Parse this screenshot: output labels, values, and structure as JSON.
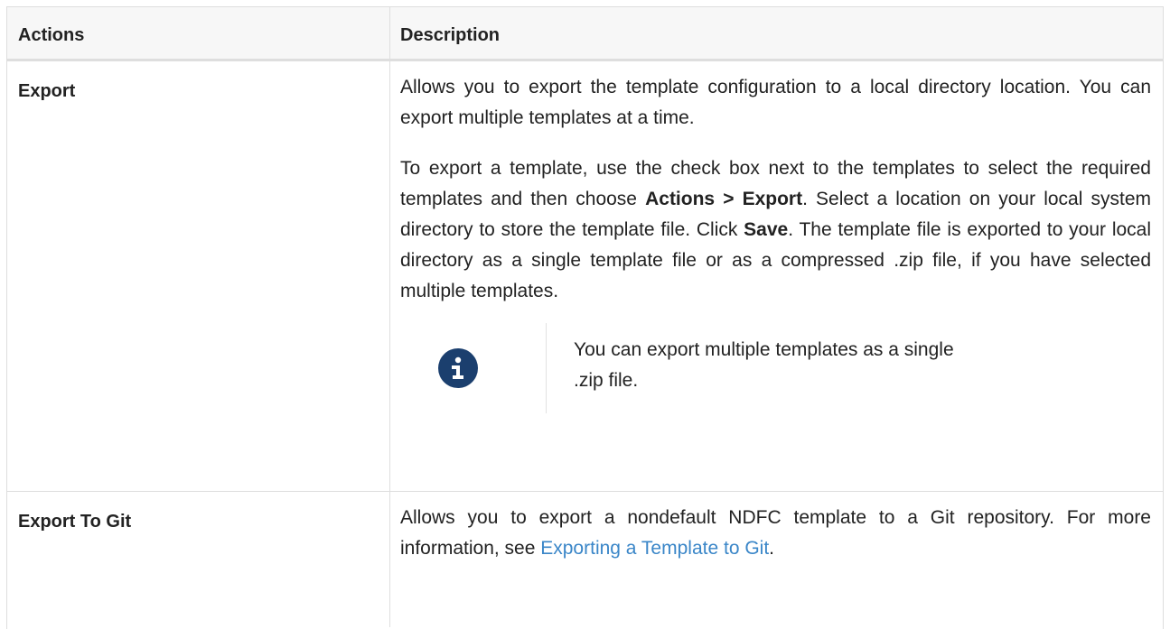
{
  "table": {
    "headers": {
      "actions": "Actions",
      "description": "Description"
    },
    "rows": [
      {
        "action": "Export",
        "p1": "Allows you to export the template configuration to a local directory location. You can export multiple templates at a time.",
        "p2_a": "To export a template, use the check box next to the templates to select the required templates and then choose ",
        "p2_b": "Actions > Export",
        "p2_c": ". Select a location on your local system directory to store the template file. Click ",
        "p2_d": "Save",
        "p2_e": ". The template file is exported to your local directory as a single template file or as a compressed .zip file, if you have selected multiple templates.",
        "note": {
          "icon": "info-icon",
          "text": "You can export multiple templates as a single .zip file."
        }
      },
      {
        "action": "Export To Git",
        "p1_a": "Allows you to export a nondefault NDFC template to a Git repository. For more information, see ",
        "link": "Exporting a Template to Git",
        "p1_b": "."
      }
    ]
  },
  "colors": {
    "header_bg": "#f7f7f7",
    "border": "#dedede",
    "link": "#3a86c8",
    "info_icon_bg": "#1b3f6e"
  }
}
